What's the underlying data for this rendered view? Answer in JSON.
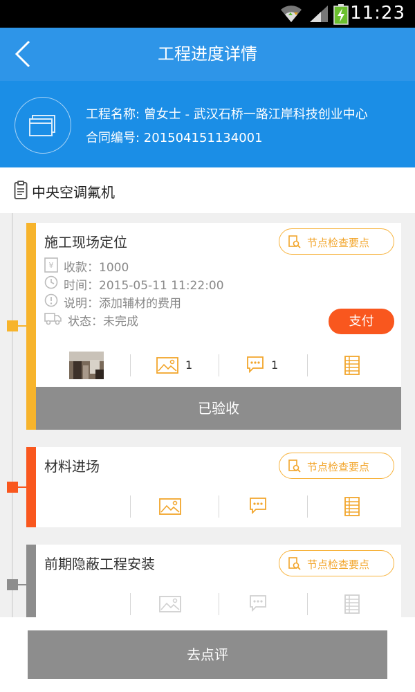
{
  "status_bar": {
    "time": "11:23"
  },
  "header": {
    "title": "工程进度详情"
  },
  "project": {
    "name_line": "工程名称: 曾女士 - 武汉石桥一路江岸科技创业中心",
    "contract_line": "合同编号: 201504151134001"
  },
  "category": {
    "label": "中央空调氟机"
  },
  "check_point_label": "节点检查要点",
  "stages": [
    {
      "title": "施工现场定位",
      "color": "#f7b42c",
      "payment": "收款：1000",
      "time": "时间：2015-05-11 11:22:00",
      "note": "说明：添加辅材的费用",
      "status": "状态：未完成",
      "pay_label": "支付",
      "image_count": "1",
      "comment_count": "1",
      "accepted_label": "已验收"
    },
    {
      "title": "材料进场",
      "color": "#f9571e"
    },
    {
      "title": "前期隐蔽工程安装",
      "color": "#8d8d8d"
    }
  ],
  "bottom": {
    "review_label": "去点评"
  },
  "colors": {
    "primary": "#2e95e8",
    "accent": "#f7b23b",
    "pay": "#f9571e",
    "gray": "#8d8d8d"
  }
}
